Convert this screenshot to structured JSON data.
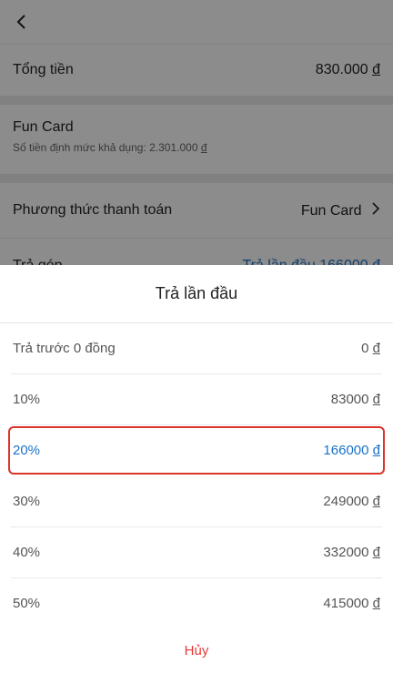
{
  "page": {
    "total_label": "Tổng tiền",
    "total_value": "830.000",
    "currency": "đ",
    "card_title": "Fun Card",
    "card_limit": "Số tiền định mức khả dụng: 2.301.000",
    "method_label": "Phương thức thanh toán",
    "method_value": "Fun Card",
    "install_label": "Trả góp",
    "install_value": "Trả lần đầu 166000"
  },
  "sheet": {
    "title": "Trả lần đầu",
    "options": [
      {
        "label": "Trả trước 0 đồng",
        "amount": "0"
      },
      {
        "label": "10%",
        "amount": "83000"
      },
      {
        "label": "20%",
        "amount": "166000"
      },
      {
        "label": "30%",
        "amount": "249000"
      },
      {
        "label": "40%",
        "amount": "332000"
      },
      {
        "label": "50%",
        "amount": "415000"
      }
    ],
    "selected_index": 2,
    "cancel_label": "Hủy"
  },
  "colors": {
    "accent": "#1a73c8",
    "cancel": "#e53935",
    "highlight_border": "#d9352b"
  },
  "icons": {
    "back": "chevron-left-icon",
    "method_chevron": "chevron-right-icon"
  }
}
